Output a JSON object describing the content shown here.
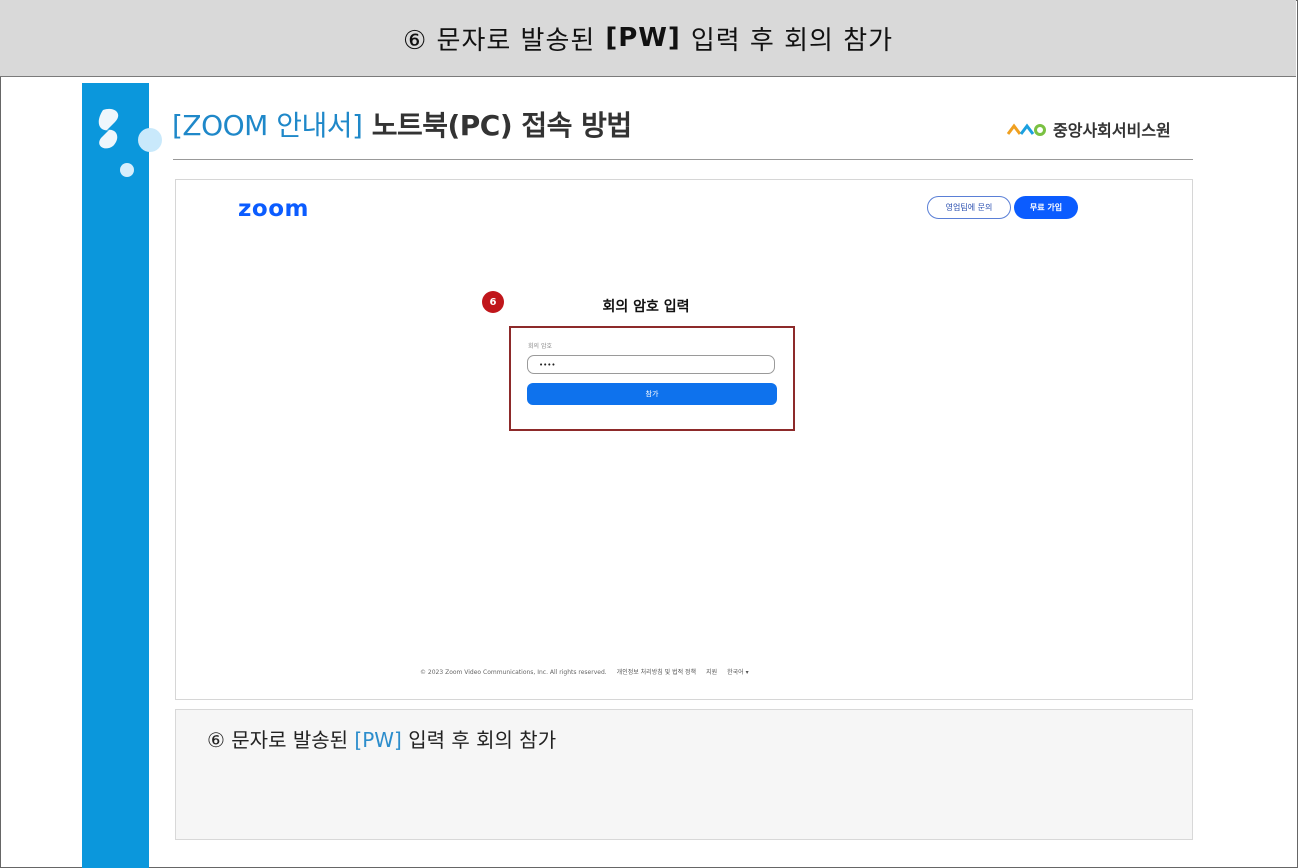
{
  "header": {
    "prefix": "⑥ 문자로 발송된",
    "bold": "[PW]",
    "suffix": "입력 후 회의 참가"
  },
  "doc": {
    "title_bracket": "[ZOOM 안내서]",
    "title_rest": " 노트북(PC) 접속 방법",
    "org_name": "중앙사회서비스원",
    "accent_color": "#0b97dc"
  },
  "zoom_page": {
    "logo": "zoom",
    "contact_sales": "영업팀에 문의",
    "sign_up": "무료 가입",
    "step_number": "6",
    "heading": "회의 암호 입력",
    "password_label": "회의 암호",
    "password_value": "••••",
    "join_button": "참가",
    "footer_copyright": "© 2023 Zoom Video Communications, Inc. All rights reserved.",
    "footer_privacy": "개인정보 처리방침 및 법적 정책",
    "footer_support": "지원",
    "footer_language": "한국어 ▾",
    "brand_color": "#0b5cff",
    "highlight_color": "#8d2a2a"
  },
  "note": {
    "prefix": "⑥ 문자로 발송된",
    "highlight": "[PW]",
    "suffix": "입력 후 회의 참가"
  }
}
